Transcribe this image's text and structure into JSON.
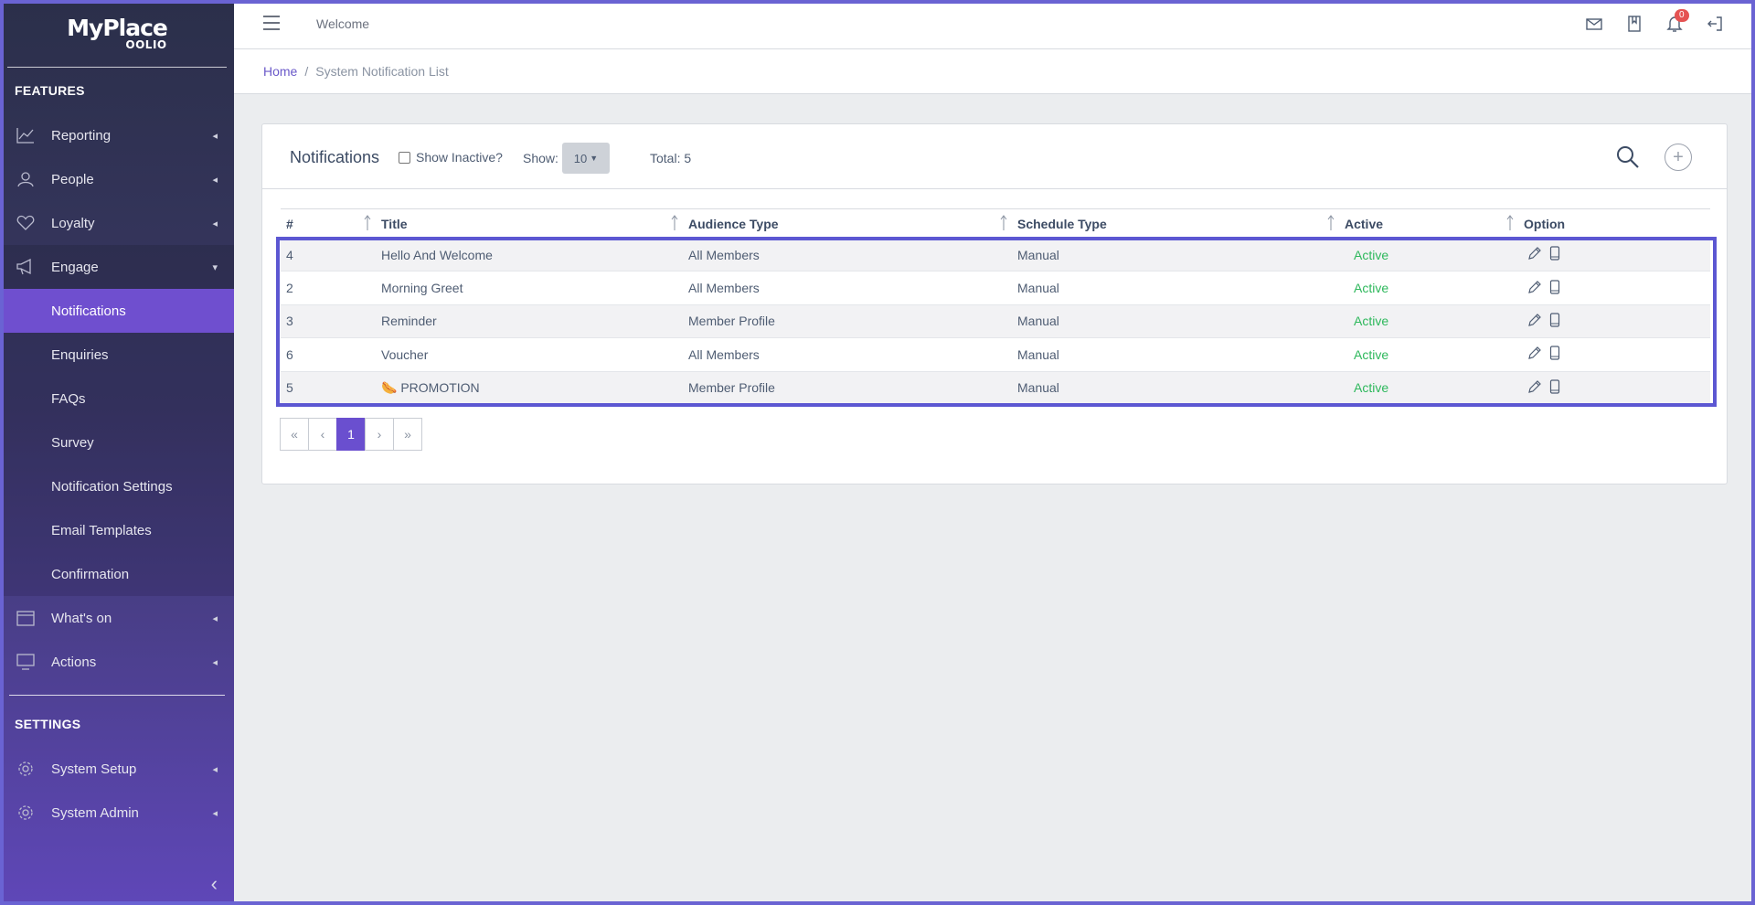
{
  "brand": {
    "name": "MyPlace",
    "sub": "OOLIO"
  },
  "sidebar": {
    "features_title": "FEATURES",
    "settings_title": "SETTINGS",
    "items": [
      {
        "label": "Reporting"
      },
      {
        "label": "People"
      },
      {
        "label": "Loyalty"
      },
      {
        "label": "Engage"
      },
      {
        "label": "What's on"
      },
      {
        "label": "Actions"
      }
    ],
    "engage_sub": [
      {
        "label": "Notifications"
      },
      {
        "label": "Enquiries"
      },
      {
        "label": "FAQs"
      },
      {
        "label": "Survey"
      },
      {
        "label": "Notification Settings"
      },
      {
        "label": "Email Templates"
      },
      {
        "label": "Confirmation"
      }
    ],
    "settings_items": [
      {
        "label": "System Setup"
      },
      {
        "label": "System Admin"
      }
    ]
  },
  "header": {
    "welcome": "Welcome",
    "notif_count": "0"
  },
  "breadcrumb": {
    "home": "Home",
    "separator": "/",
    "current": "System Notification List"
  },
  "card": {
    "title": "Notifications",
    "show_inactive_label": "Show Inactive?",
    "show_label": "Show:",
    "show_value": "10",
    "total_text": "Total: 5"
  },
  "table": {
    "headers": [
      "#",
      "Title",
      "Audience Type",
      "Schedule Type",
      "Active",
      "Option"
    ],
    "rows": [
      {
        "id": "4",
        "title": "Hello And Welcome",
        "audience": "All Members",
        "schedule": "Manual",
        "active": "Active"
      },
      {
        "id": "2",
        "title": "Morning Greet",
        "audience": "All Members",
        "schedule": "Manual",
        "active": "Active"
      },
      {
        "id": "3",
        "title": "Reminder",
        "audience": "Member Profile",
        "schedule": "Manual",
        "active": "Active"
      },
      {
        "id": "6",
        "title": "Voucher",
        "audience": "All Members",
        "schedule": "Manual",
        "active": "Active"
      },
      {
        "id": "5",
        "title": "🌭 PROMOTION",
        "audience": "Member Profile",
        "schedule": "Manual",
        "active": "Active"
      }
    ]
  },
  "pagination": {
    "first": "«",
    "prev": "‹",
    "current": "1",
    "next": "›",
    "last": "»"
  },
  "colors": {
    "accent": "#6a4fcf",
    "active_green": "#2eb85c",
    "frame": "#5c57d2"
  }
}
